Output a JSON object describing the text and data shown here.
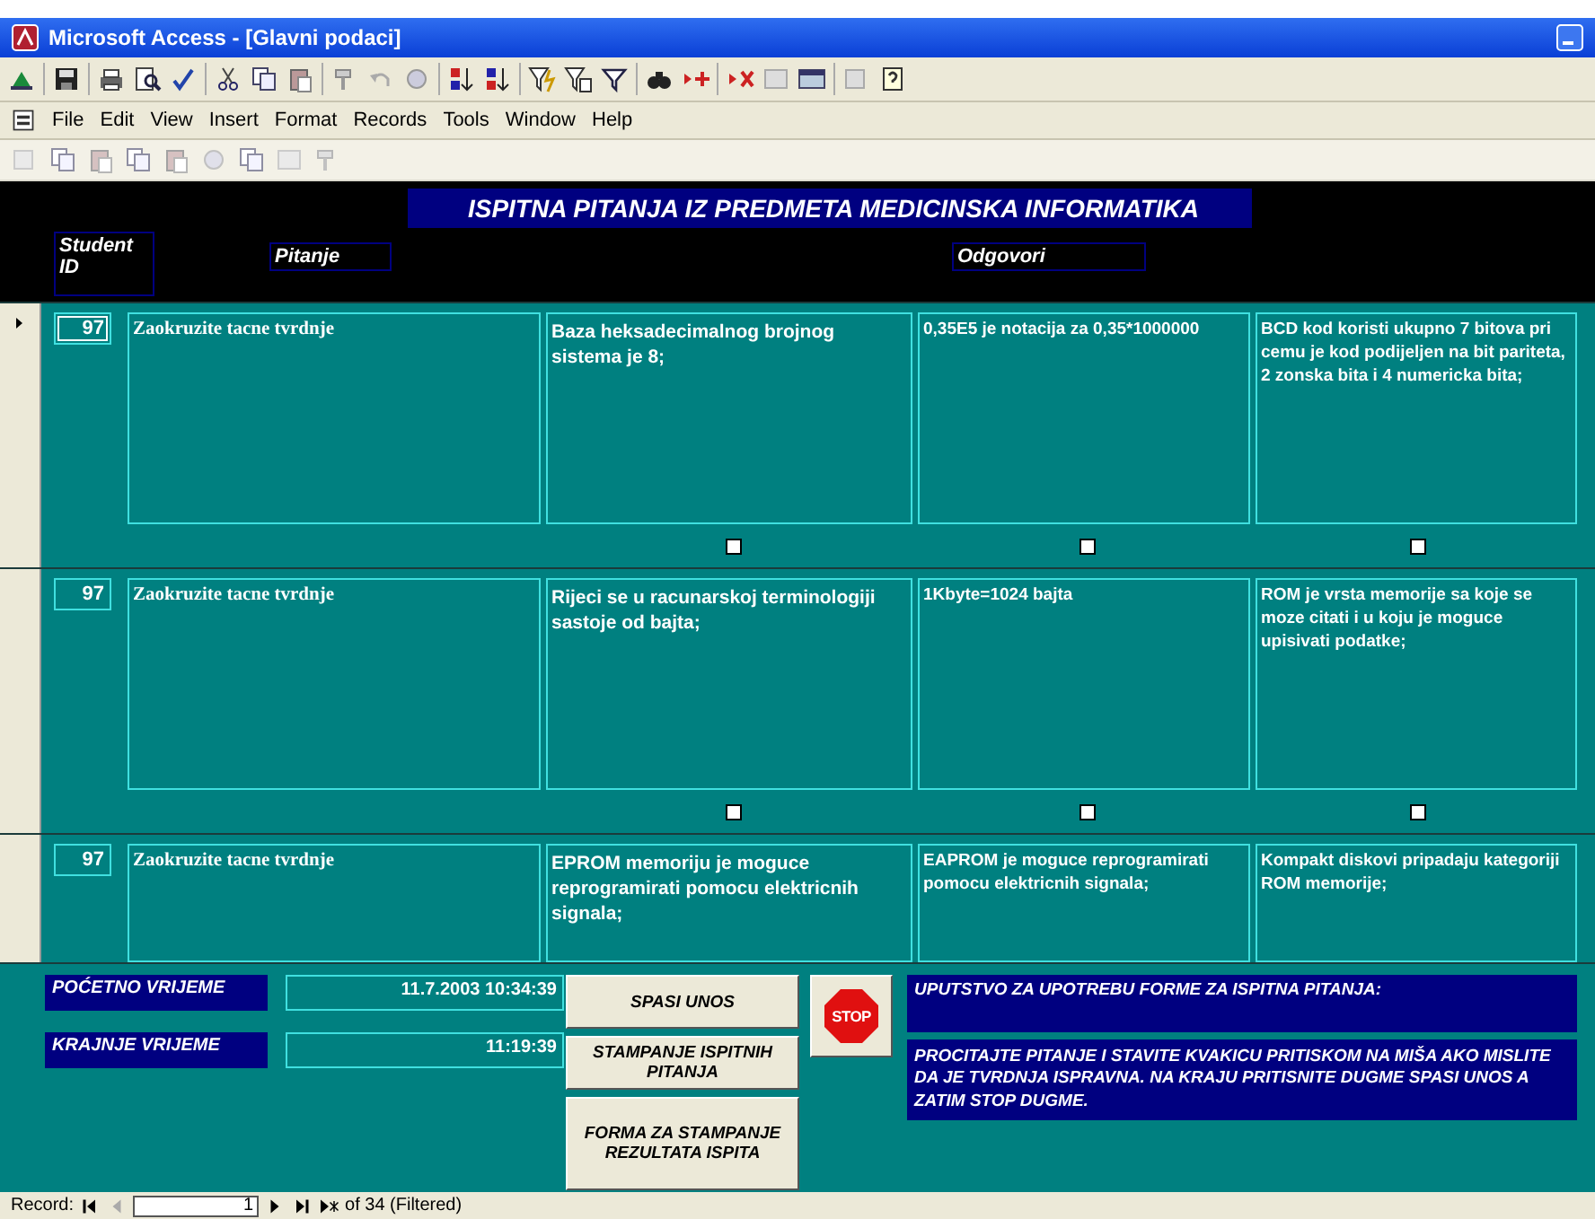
{
  "window": {
    "title": "Microsoft Access - [Glavni podaci]"
  },
  "menu": [
    "File",
    "Edit",
    "View",
    "Insert",
    "Format",
    "Records",
    "Tools",
    "Window",
    "Help"
  ],
  "form": {
    "title": "ISPITNA PITANJA IZ PREDMETA MEDICINSKA INFORMATIKA",
    "columns": [
      {
        "label": "Student ID"
      },
      {
        "label": "Pitanje"
      },
      {
        "label": "Odgovori"
      }
    ],
    "records": [
      {
        "current": true,
        "id": "97",
        "question": "Zaokruzite tacne tvrdnje",
        "answers": [
          {
            "text": "Baza heksadecimalnog brojnog sistema je 8;",
            "checked": false
          },
          {
            "text": "0,35E5 je notacija za 0,35*1000000",
            "checked": false
          },
          {
            "text": "BCD kod koristi ukupno 7 bitova pri cemu je kod podijeljen na bit pariteta, 2 zonska bita i 4 numericka bita;",
            "checked": false
          }
        ]
      },
      {
        "current": false,
        "id": "97",
        "question": "Zaokruzite tacne tvrdnje",
        "answers": [
          {
            "text": "Rijeci se u racunarskoj terminologiji sastoje od bajta;",
            "checked": false
          },
          {
            "text": "1Kbyte=1024 bajta",
            "checked": false
          },
          {
            "text": "ROM je vrsta memorije sa koje se moze citati i u koju je moguce upisivati podatke;",
            "checked": false
          }
        ]
      },
      {
        "current": false,
        "id": "97",
        "question": "Zaokruzite tacne tvrdnje",
        "answers": [
          {
            "text": "EPROM memoriju je moguce reprogramirati pomocu elektricnih signala;"
          },
          {
            "text": "EAPROM je moguce reprogramirati pomocu elektricnih signala;"
          },
          {
            "text": "Kompakt diskovi pripadaju kategoriji ROM memorije;"
          }
        ]
      }
    ]
  },
  "footer": {
    "start_label": "POĆETNO VRIJEME",
    "start_value": "11.7.2003 10:34:39",
    "end_label": "KRAJNJE VRIJEME",
    "end_value": "11:19:39",
    "buttons": [
      "SPASI UNOS",
      "STAMPANJE ISPITNIH PITANJA",
      "FORMA ZA STAMPANJE REZULTATA ISPITA"
    ],
    "stop_label": "STOP",
    "instructions_title": "UPUTSTVO ZA UPOTREBU FORME ZA ISPITNA PITANJA:",
    "instructions": "PROCITAJTE PITANJE I STAVITE KVAKICU PRITISKOM NA MIŠA AKO MISLITE DA JE TVRDNJA ISPRAVNA. NA KRAJU PRITISNITE DUGME SPASI UNOS A ZATIM STOP DUGME."
  },
  "navigation": {
    "label": "Record:",
    "record": "1",
    "total": "of  34 (Filtered)"
  }
}
